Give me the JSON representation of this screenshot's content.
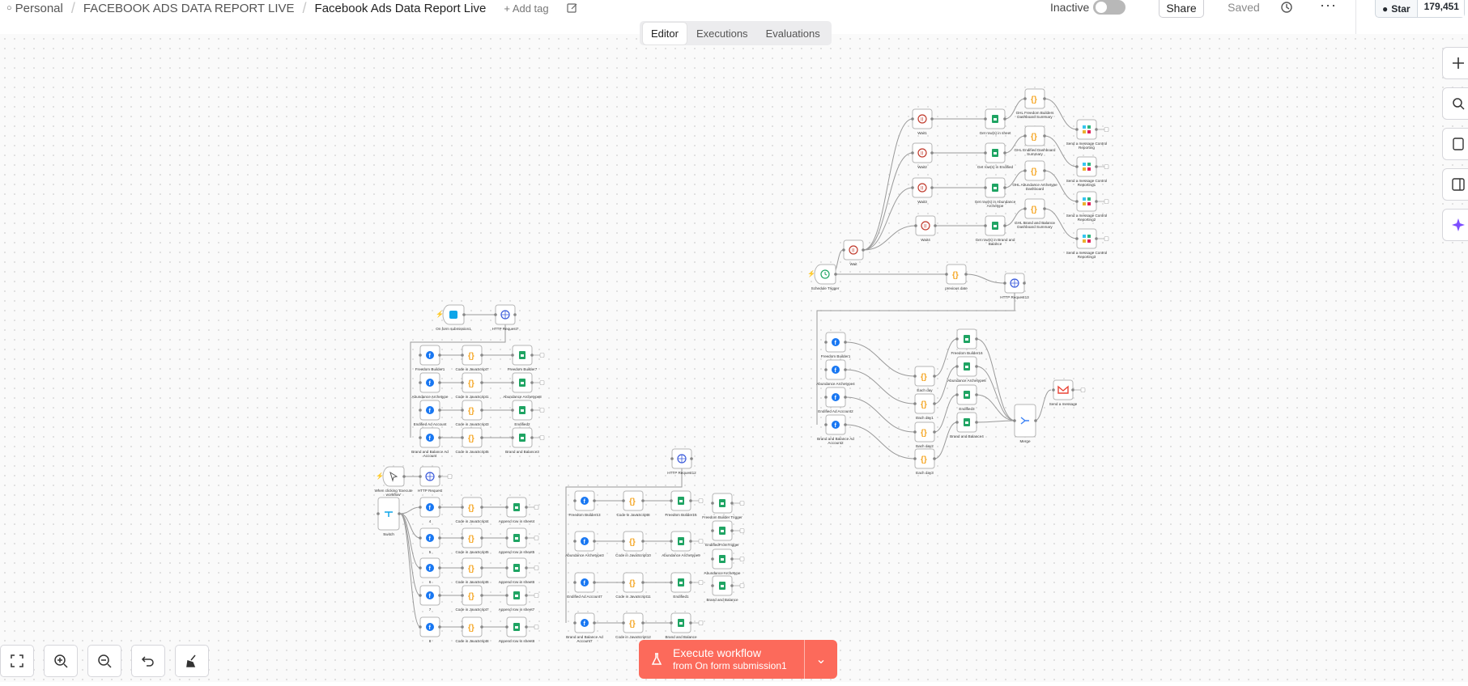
{
  "breadcrumb": {
    "owner": "Personal",
    "folder": "FACEBOOK ADS DATA REPORT LIVE",
    "workflow_name": "Facebook Ads Data Report Live",
    "add_tag": "+ Add tag"
  },
  "header": {
    "status_label": "Inactive",
    "share_label": "Share",
    "saved_label": "Saved",
    "more_label": "···",
    "github_star_label": "Star",
    "github_star_count": "179,451"
  },
  "tabs": [
    "Editor",
    "Executions",
    "Evaluations"
  ],
  "execute": {
    "label": "Execute workflow",
    "sublabel": "from On form submission1"
  },
  "colors": {
    "accent": "#fc6a5b",
    "facebook": "#1877f2",
    "sheets": "#1fa463",
    "code": "#f5a623",
    "wait": "#c0392b"
  },
  "nodes": {
    "group_schedule": {
      "trigger": "Schedule Trigger",
      "wait_main": "Wait",
      "waits": [
        "Wait1",
        "Wait2",
        "Wait3",
        "Wait4"
      ],
      "sheets": [
        "Get row(s) in sheet",
        "Get row(s) in Endified",
        "Get row(s) in Abundance Archetype",
        "Get row(s) in Brand and Balance"
      ],
      "codes": [
        "GHL Freedom Builders Dashboard Summary",
        "GHL Endified Dashboard Summary",
        "GHL Abundance Archetype Dashboard",
        "GHL Brand and Balance Dashboard Summary"
      ],
      "slack": [
        "Send a message Control Reporting",
        "Send a message Control Reporting1",
        "Send a message Control Reporting2",
        "Send a message Control Reporting3"
      ],
      "prev_date": "previous date",
      "http": "HTTP Request13",
      "fb": [
        "Freedom Builder1",
        "Abundance Archetype4",
        "Endified Ad Account2",
        "Brand and Balance Ad Account2"
      ],
      "each": [
        "Each day",
        "Each day1",
        "Each day2",
        "Each day3"
      ],
      "out_sheets": [
        "Freedom Builder16",
        "Abundance Archetype6",
        "Endified3",
        "Brand and Balance4"
      ],
      "merge": "Merge",
      "gmail": "Send a message"
    },
    "group_form": {
      "trigger": "On form submission1",
      "http": "HTTP Request7",
      "fb": [
        "Freedom Builder1",
        "Abundance Archetype",
        "Endified Ad Account",
        "Brand and Balance Ad Account"
      ],
      "codes": [
        "Code in JavaScript7",
        "Code in JavaScript1",
        "Code in JavaScript3",
        "Code in JavaScript5"
      ],
      "sheets": [
        "Freedom Builder7",
        "Abundance Archetype8",
        "Endified2",
        "Brand and Balance3"
      ]
    },
    "group_manual": {
      "trigger": "When clicking 'Execute workflow'",
      "http": "HTTP Request",
      "switch": "Switch",
      "fb": [
        "4",
        "5",
        "6",
        "7",
        "8"
      ],
      "codes": [
        "Code in JavaScript4",
        "Code in JavaScript5",
        "Code in JavaScript6",
        "Code in JavaScript7",
        "Code in JavaScript8"
      ],
      "sheets": [
        "Append row in sheet4",
        "Append row in sheet5",
        "Append row in sheet6",
        "Append row in sheet7",
        "Append row in sheet8"
      ]
    },
    "group_http12": {
      "http": "HTTP Request12",
      "fb": [
        "Freedom Builder13",
        "Abundance Archetype3",
        "Endified Ad Account7",
        "Brand and Balance Ad Account7"
      ],
      "codes": [
        "Code in JavaScript8",
        "Code in JavaScript10",
        "Code in JavaScript11",
        "Code in JavaScript12"
      ],
      "sheets": [
        "Freedom Builder15",
        "Abundance Archetype9",
        "Endified1",
        "Brand and Balance"
      ],
      "extra": [
        "Freedom Builder Trigger",
        "EndifiedFromTrigger",
        "Abundance Archetype",
        "Brand and Balance"
      ]
    }
  }
}
